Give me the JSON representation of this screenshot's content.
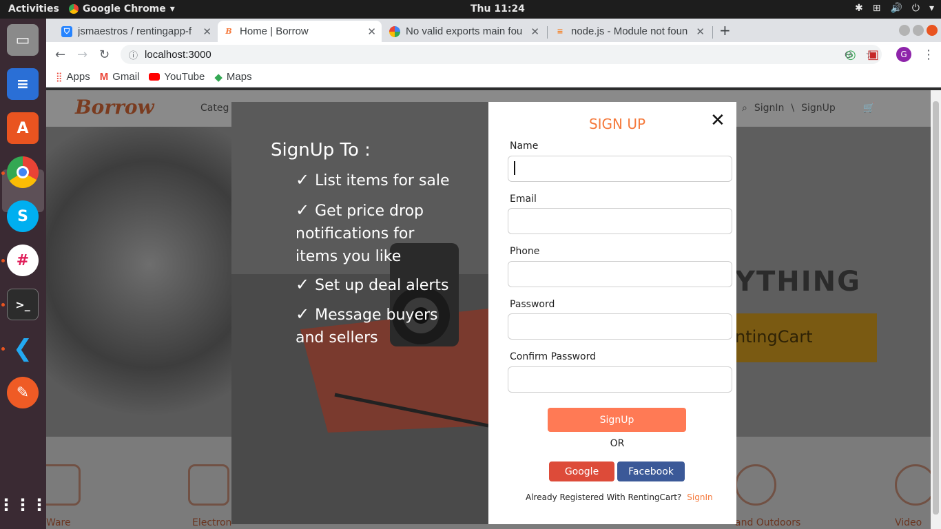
{
  "topbar": {
    "activities": "Activities",
    "app_name": "Google Chrome",
    "clock": "Thu 11:24"
  },
  "browser": {
    "tabs": [
      {
        "title": "jsmaestros / rentingapp-f",
        "favicon": "bitbucket-icon",
        "color": "#2684ff"
      },
      {
        "title": "Home | Borrow",
        "favicon": "borrow-icon",
        "color": "#f5793b"
      },
      {
        "title": "No valid exports main fou",
        "favicon": "google-icon",
        "color": "#4285f4"
      },
      {
        "title": "node.js - Module not foun",
        "favicon": "stackoverflow-icon",
        "color": "#f48024"
      }
    ],
    "url": "localhost:3000",
    "bookmarks": [
      {
        "label": "Apps",
        "icon": "apps-grid-icon"
      },
      {
        "label": "Gmail",
        "icon": "gmail-icon"
      },
      {
        "label": "YouTube",
        "icon": "youtube-icon"
      },
      {
        "label": "Maps",
        "icon": "maps-icon"
      }
    ],
    "profile_initial": "G"
  },
  "site": {
    "logo": "Borrow",
    "nav_partial": "Categ",
    "signin": "SignIn",
    "separator": "\\",
    "signup": "SignUp",
    "hero_text_partial": "YTHING",
    "hero_button_partial": "ntingCart",
    "categories_partial": [
      "Ware",
      "Electron",
      "and Outdoors",
      "Video"
    ]
  },
  "promo": {
    "title": "SignUp To :",
    "check": "✓",
    "items": [
      "List items for sale",
      "Get price drop notifications for items you like",
      "Set up deal alerts",
      "Message buyers and sellers"
    ]
  },
  "signup_form": {
    "title": "SIGN UP",
    "close": "✕",
    "fields": [
      {
        "label": "Name",
        "value": ""
      },
      {
        "label": "Email",
        "value": ""
      },
      {
        "label": "Phone",
        "value": ""
      },
      {
        "label": "Password",
        "value": ""
      },
      {
        "label": "Confirm Password",
        "value": ""
      }
    ],
    "submit": "SignUp",
    "or": "OR",
    "google": "Google",
    "facebook": "Facebook",
    "already": "Already Registered With RentingCart?",
    "signin": "SignIn"
  },
  "colors": {
    "accent": "#f5793b",
    "signup_button": "#ff7a55",
    "google": "#dd4b39",
    "facebook": "#3b5998"
  }
}
